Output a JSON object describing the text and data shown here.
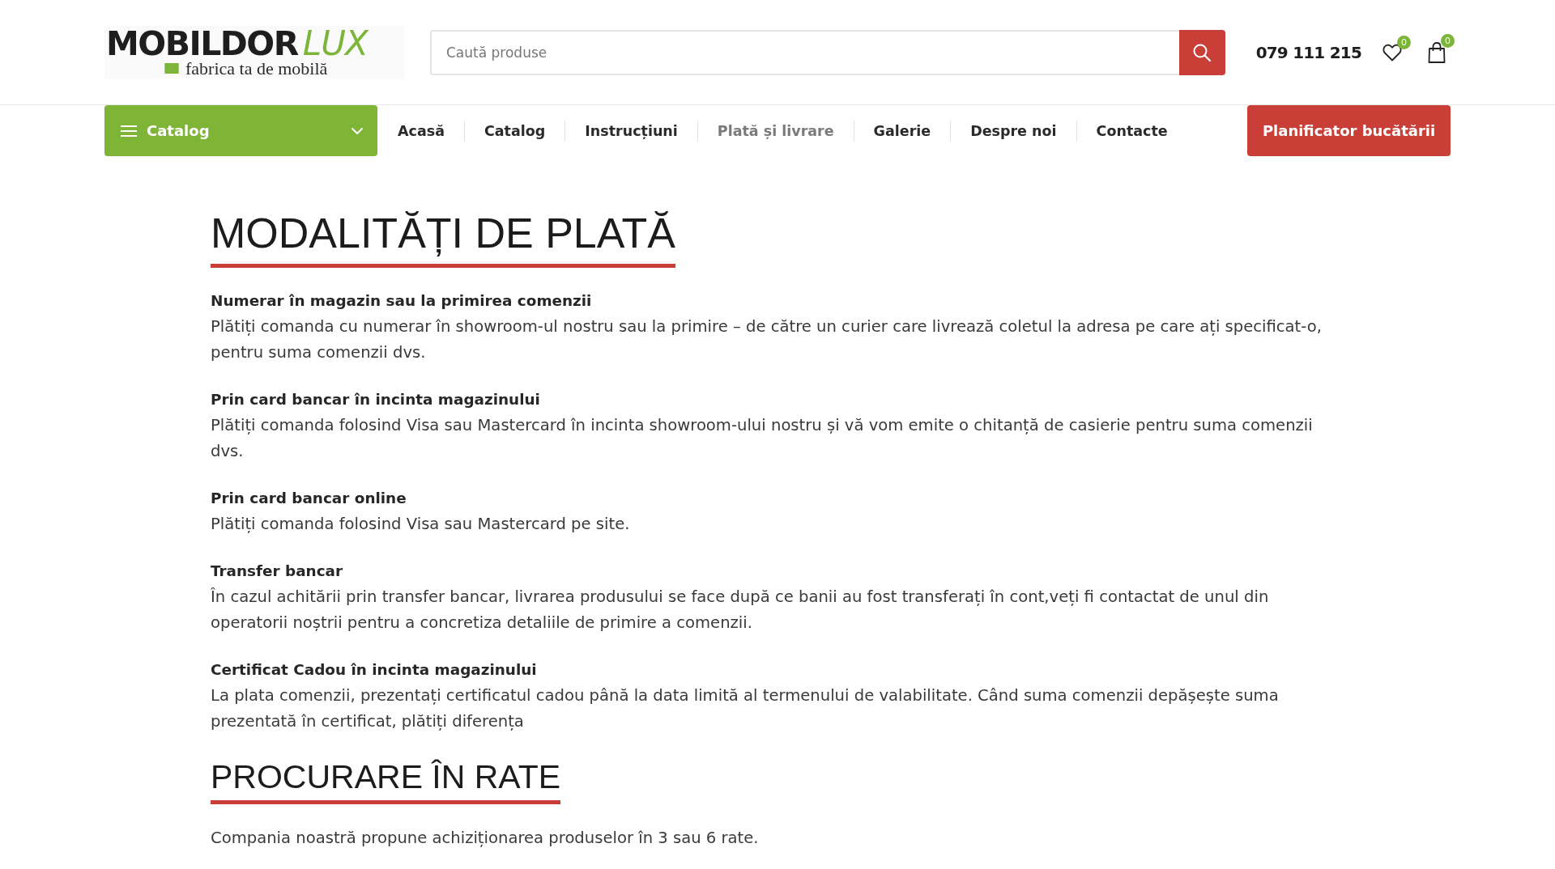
{
  "header": {
    "logo": {
      "brand": "MOBILDOR",
      "suffix": "LUX",
      "tagline": "fabrica ta de mobilă"
    },
    "search": {
      "placeholder": "Caută produse"
    },
    "phone": "079 111 215",
    "wishlist": {
      "count": "0"
    },
    "cart": {
      "count": "0"
    }
  },
  "nav": {
    "catalog_button": "Catalog",
    "items": [
      {
        "label": "Acasă",
        "selected": false
      },
      {
        "label": "Catalog",
        "selected": false
      },
      {
        "label": "Instrucțiuni",
        "selected": false
      },
      {
        "label": "Plată și livrare",
        "selected": true
      },
      {
        "label": "Galerie",
        "selected": false
      },
      {
        "label": "Despre noi",
        "selected": false
      },
      {
        "label": "Contacte",
        "selected": false
      }
    ],
    "cta": "Planificator bucătării"
  },
  "sections": [
    {
      "title": "MODALITĂȚI DE PLATĂ",
      "blocks": [
        {
          "heading": "Numerar în magazin sau la primirea comenzii",
          "text": "Plătiți comanda cu numerar în showroom-ul nostru sau la primire – de către un curier care livrează coletul la adresa pe care ați specificat-o, pentru suma comenzii dvs."
        },
        {
          "heading": "Prin card bancar în incinta magazinului",
          "text": "Plătiți comanda folosind Visa sau Mastercard în incinta showroom-ului nostru și vă vom emite o chitanță de casierie pentru suma comenzii dvs."
        },
        {
          "heading": "Prin card bancar online",
          "text": "Plătiți comanda folosind Visa sau Mastercard pe site."
        },
        {
          "heading": "Transfer bancar",
          "text": "În cazul achitării prin transfer bancar, livrarea produsului se face după ce banii au fost transferați în cont,veți fi contactat de unul din operatorii noștrii pentru a concretiza detaliile de primire a comenzii."
        },
        {
          "heading": "Certificat Cadou în incinta magazinului",
          "text": "La plata comenzii, prezentați certificatul cadou până la data limită al termenului de valabilitate. Când suma comenzii depășește suma prezentată în certificat, plătiți diferența"
        }
      ]
    },
    {
      "title": "PROCURARE ÎN RATE",
      "blocks": [
        {
          "text": "Compania noastră propune achiziționarea produselor în 3 sau 6 rate."
        }
      ]
    }
  ]
}
